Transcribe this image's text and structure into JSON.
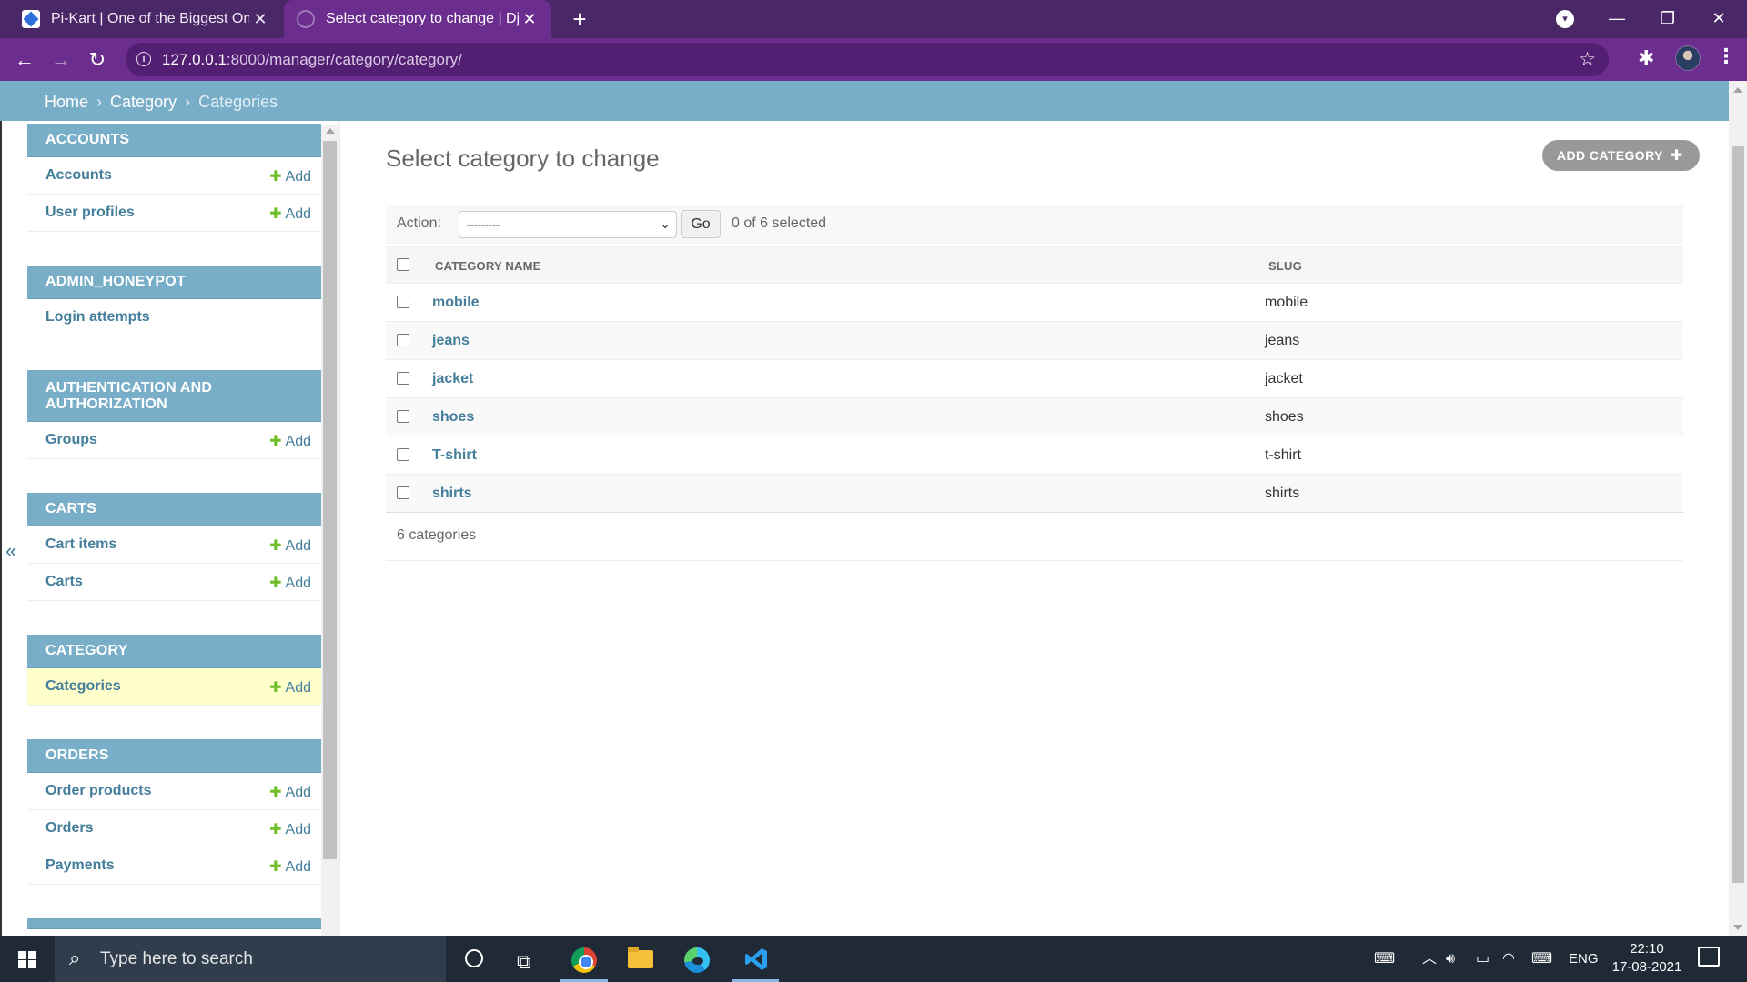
{
  "browser": {
    "tabs": [
      {
        "title": "Pi-Kart | One of the Biggest Online Store"
      },
      {
        "title": "Select category to change | Django site admin"
      }
    ],
    "new_tab_symbol": "+",
    "url": "127.0.0.1",
    "url_rest": ":8000/manager/category/category/"
  },
  "breadcrumbs": {
    "home": "Home",
    "app": "Category",
    "current": "Categories",
    "sep": "›"
  },
  "sidebar": {
    "modules": [
      {
        "caption": "ACCOUNTS",
        "rows": [
          {
            "label": "Accounts",
            "add": "Add"
          },
          {
            "label": "User profiles",
            "add": "Add"
          }
        ]
      },
      {
        "caption": "ADMIN_HONEYPOT",
        "rows": [
          {
            "label": "Login attempts"
          }
        ]
      },
      {
        "caption": "AUTHENTICATION AND AUTHORIZATION",
        "rows": [
          {
            "label": "Groups",
            "add": "Add"
          }
        ]
      },
      {
        "caption": "CARTS",
        "rows": [
          {
            "label": "Cart items",
            "add": "Add"
          },
          {
            "label": "Carts",
            "add": "Add"
          }
        ]
      },
      {
        "caption": "CATEGORY",
        "rows": [
          {
            "label": "Categories",
            "add": "Add"
          }
        ]
      },
      {
        "caption": "ORDERS",
        "rows": [
          {
            "label": "Order products",
            "add": "Add"
          },
          {
            "label": "Orders",
            "add": "Add"
          },
          {
            "label": "Payments",
            "add": "Add"
          }
        ]
      }
    ],
    "collapse_symbol": "«"
  },
  "main": {
    "title": "Select category to change",
    "add_button": "ADD CATEGORY",
    "action_label": "Action:",
    "action_value": "---------",
    "go_label": "Go",
    "selected_text": "0 of 6 selected",
    "columns": [
      "CATEGORY NAME",
      "SLUG"
    ],
    "rows": [
      {
        "name": "mobile",
        "slug": "mobile"
      },
      {
        "name": "jeans",
        "slug": "jeans"
      },
      {
        "name": "jacket",
        "slug": "jacket"
      },
      {
        "name": "shoes",
        "slug": "shoes"
      },
      {
        "name": "T-shirt",
        "slug": "t-shirt"
      },
      {
        "name": "shirts",
        "slug": "shirts"
      }
    ],
    "paginator": "6 categories"
  },
  "taskbar": {
    "search_placeholder": "Type here to search",
    "language": "ENG",
    "time": "22:10",
    "date": "17-08-2021"
  },
  "colors": {
    "header_purple": "#6b2d8e",
    "tabbar_purple": "#4a2868",
    "admin_blue": "#79aec8",
    "link_blue": "#447e9b",
    "add_green": "#70bf2b",
    "current_row": "#ffffcc"
  }
}
